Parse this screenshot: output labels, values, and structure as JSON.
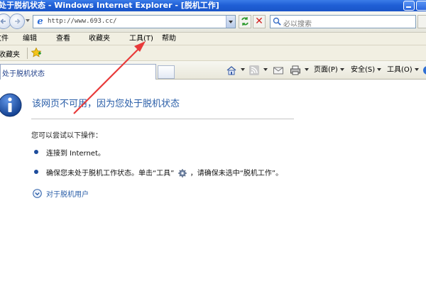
{
  "window": {
    "title": "处于脱机状态 - Windows Internet Explorer - [脱机工作]"
  },
  "address_bar": {
    "url": "http://www.693.cc/"
  },
  "search": {
    "placeholder": "必以搜索"
  },
  "menu": {
    "items": [
      {
        "label": "文件"
      },
      {
        "label": "编辑"
      },
      {
        "label": "查看"
      },
      {
        "label": "收藏夹"
      },
      {
        "label": "工具(T)"
      },
      {
        "label": "帮助"
      }
    ]
  },
  "favorites": {
    "label": "收藏夹"
  },
  "tab": {
    "title": "处于脱机状态"
  },
  "commandbar": {
    "page": "页面(P)",
    "safety": "安全(S)",
    "tools": "工具(O)"
  },
  "content": {
    "heading": "该网页不可用，因为您处于脱机状态",
    "subheading": "您可以尝试以下操作：",
    "bullets": [
      {
        "text": "连接到 Internet。"
      },
      {
        "text_before": "确保您未处于脱机工作状态。单击“工具”",
        "text_after": "，请确保未选中“脱机工作”。"
      }
    ],
    "expander": "对于脱机用户"
  },
  "colors": {
    "titlebar": "#1f5fd6",
    "heading": "#2a5ea8",
    "annotation_arrow": "#e83a3a"
  }
}
